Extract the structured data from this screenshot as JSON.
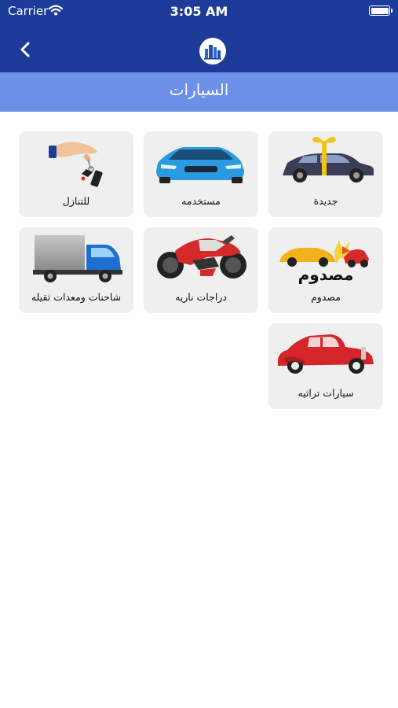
{
  "status_bar": {
    "carrier": "Carrier",
    "time": "3:05 AM"
  },
  "header": {
    "title": "السيارات",
    "back_icon": "chevron-left-icon",
    "logo_icon": "city-buildings-logo"
  },
  "colors": {
    "header": "#1d3c9a",
    "title_bar": "#6c8fe8",
    "card": "#efefef"
  },
  "categories": [
    {
      "label": "جديدة",
      "icon": "new-car-gift-icon"
    },
    {
      "label": "مستخدمه",
      "icon": "used-car-icon"
    },
    {
      "label": "للتنازل",
      "icon": "car-keys-icon"
    },
    {
      "label": "مصدوم",
      "icon": "crashed-cars-icon",
      "image_text": "مصدوم"
    },
    {
      "label": "دراجات ناريه",
      "icon": "motorcycle-icon"
    },
    {
      "label": "شاحنات ومعدات ثقيله",
      "icon": "truck-icon"
    },
    {
      "label": "سيارات تراثيه",
      "icon": "classic-car-icon"
    }
  ]
}
